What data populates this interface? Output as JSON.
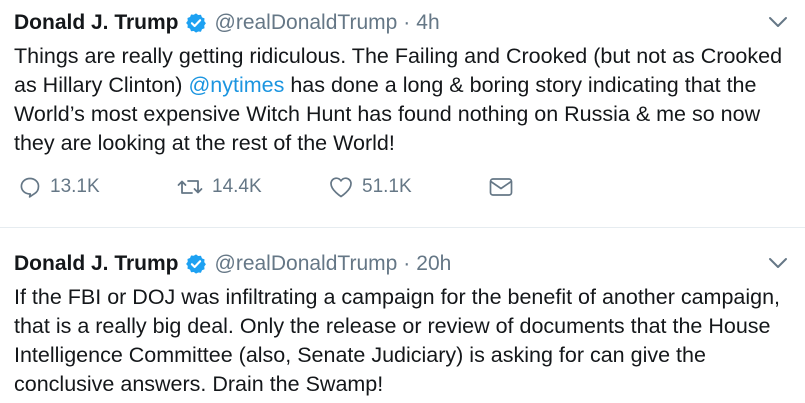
{
  "tweets": [
    {
      "author": {
        "name": "Donald J. Trump",
        "handle": "@realDonaldTrump"
      },
      "time": "4h",
      "text_before": "Things are really getting ridiculous. The Failing and Crooked (but not as Crooked as Hillary Clinton) ",
      "mention": "@nytimes",
      "text_after": " has done a long & boring story indicating that the World’s most expensive Witch Hunt has found nothing on Russia & me so now they are looking at the rest of the World!",
      "replies": "13.1K",
      "retweets": "14.4K",
      "likes": "51.1K"
    },
    {
      "author": {
        "name": "Donald J. Trump",
        "handle": "@realDonaldTrump"
      },
      "time": "20h",
      "text": "If the FBI or DOJ was infiltrating a campaign for the benefit of another campaign, that is a really big deal. Only the release or review of documents that the House Intelligence Committee (also, Senate Judiciary) is asking for can give the conclusive answers. Drain the Swamp!"
    }
  ],
  "ui": {
    "separator": "·",
    "icons": {
      "verified": "verified-badge-icon",
      "caret": "chevron-down-icon",
      "reply": "reply-icon",
      "retweet": "retweet-icon",
      "like": "heart-icon",
      "dm": "envelope-icon"
    },
    "colors": {
      "accent": "#1da1f2",
      "link": "#1b95e0",
      "muted": "#657786",
      "text": "#14171a",
      "border": "#e6ecf0"
    }
  }
}
